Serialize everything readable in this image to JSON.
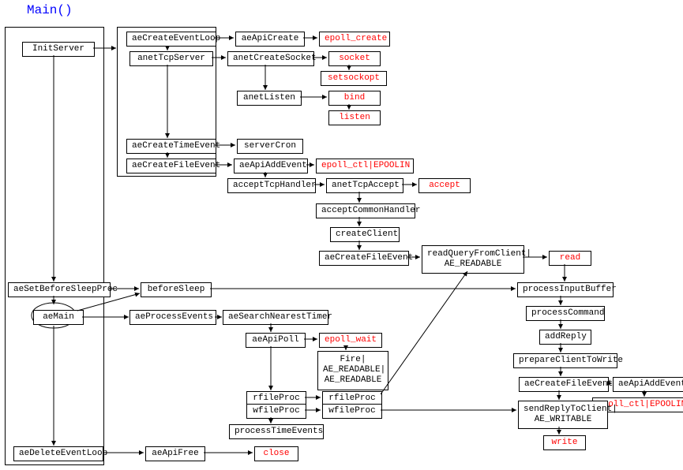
{
  "title": "Main()",
  "nodes": {
    "initServer": "InitServer",
    "aeCreateEventLoop": "aeCreateEventLoop",
    "aeApiCreate": "aeApiCreate",
    "epoll_create": "epoll_create",
    "anetTcpServer": "anetTcpServer",
    "anetCreateSocket": "anetCreateSocket",
    "socket": "socket",
    "setsockopt": "setsockopt",
    "anetListen": "anetListen",
    "bind": "bind",
    "listen": "listen",
    "aeCreateTimeEvent": "aeCreateTimeEvent",
    "serverCron": "serverCron",
    "aeCreateFileEvent": "aeCreateFileEvent",
    "aeApiAddEvent": "aeApiAddEvent",
    "epoll_ctl_in": "epoll_ctl|EPOOLIN",
    "acceptTcpHandler": "acceptTcpHandler",
    "anetTcpAccept": "anetTcpAccept",
    "accept": "accept",
    "acceptCommonHandler": "acceptCommonHandler",
    "createClient": "createClient",
    "aeCreateFileEvent2": "aeCreateFileEvent",
    "readQueryFromClient": "readQueryFromClient|\nAE_READABLE",
    "read": "read",
    "aeSetBeforeSleepProc": "aeSetBeforeSleepProc",
    "beforeSleep": "beforeSleep",
    "processInputBuffer": "processInputBuffer",
    "aeMain": "aeMain",
    "aeProcessEvents": "aeProcessEvents",
    "aeSearchNearestTimer": "aeSearchNearestTimer",
    "processCommand": "processCommand",
    "aeApiPoll": "aeApiPoll",
    "epoll_wait": "epoll_wait",
    "addReply": "addReply",
    "fire": "Fire|\nAE_READABLE|\nAE_READABLE",
    "prepareClientToWrite": "prepareClientToWrite",
    "rfileProc1": "rfileProc",
    "wfileProc1": "wfileProc",
    "rfileProc2": "rfileProc",
    "wfileProc2": "wfileProc",
    "aeCreateFileEvent3": "aeCreateFileEvent",
    "aeApiAddEvent2": "aeApiAddEvent",
    "epoll_ctl_in2": "epoll_ctl|EPOOLIN",
    "sendReplyToClient": "sendReplyToClient|\nAE_WRITABLE",
    "processTimeEvents": "processTimeEvents",
    "write": "write",
    "aeDeleteEventLoop": "aeDeleteEventLoop",
    "aeApiFree": "aeApiFree",
    "close": "close"
  }
}
